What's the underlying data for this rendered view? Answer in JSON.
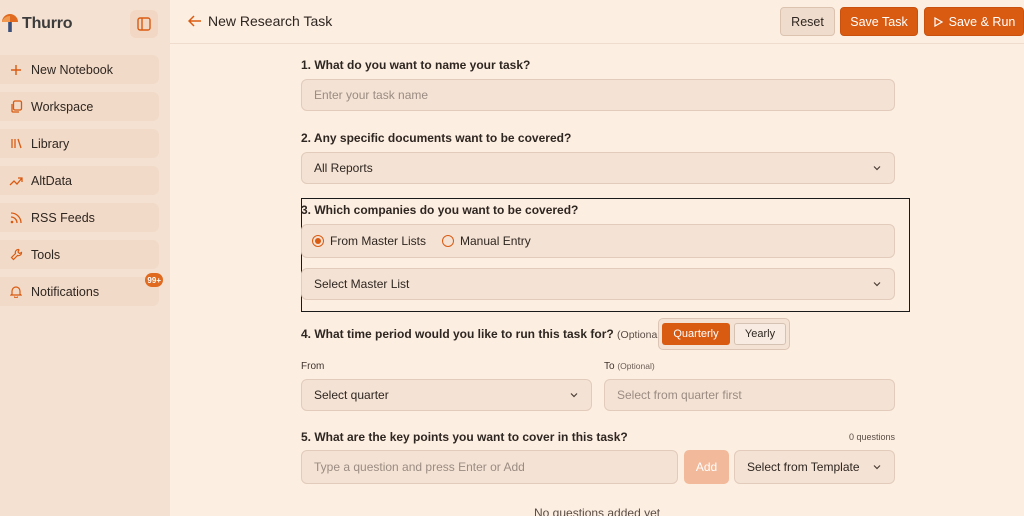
{
  "sidebar": {
    "brand": "Thurro",
    "items": [
      {
        "label": "New Notebook",
        "icon": "plus-icon"
      },
      {
        "label": "Workspace",
        "icon": "copy-icon"
      },
      {
        "label": "Library",
        "icon": "library-icon"
      },
      {
        "label": "AltData",
        "icon": "trend-icon"
      },
      {
        "label": "RSS Feeds",
        "icon": "rss-icon"
      },
      {
        "label": "Tools",
        "icon": "wrench-icon"
      },
      {
        "label": "Notifications",
        "icon": "bell-icon",
        "badge": "99+"
      }
    ]
  },
  "header": {
    "title": "New Research Task",
    "reset_label": "Reset",
    "save_label": "Save Task",
    "run_label": "Save & Run"
  },
  "form": {
    "q1": {
      "label": "1. What do you want to name your task?",
      "placeholder": "Enter your task name"
    },
    "q2": {
      "label": "2. Any specific documents want to be covered?",
      "value": "All Reports"
    },
    "q3": {
      "label": "3. Which companies do you want to be covered?",
      "option_master": "From Master Lists",
      "option_manual": "Manual Entry",
      "select_placeholder": "Select Master List"
    },
    "q4": {
      "label": "4. What time period would you like to run this task for?",
      "optional": "(Optional)",
      "toggle_quarterly": "Quarterly",
      "toggle_yearly": "Yearly",
      "from_label": "From",
      "from_placeholder": "Select quarter",
      "to_label": "To",
      "to_optional": "(Optional)",
      "to_placeholder": "Select from quarter first"
    },
    "q5": {
      "label": "5. What are the key points you want to cover in this task?",
      "count": "0 questions",
      "input_placeholder": "Type a question and press Enter or Add",
      "add_label": "Add",
      "template_label": "Select from Template",
      "empty_text": "No questions added yet"
    }
  },
  "colors": {
    "accent": "#d95b12",
    "background": "#fdeee2",
    "sidebar": "#f5e1d2"
  }
}
